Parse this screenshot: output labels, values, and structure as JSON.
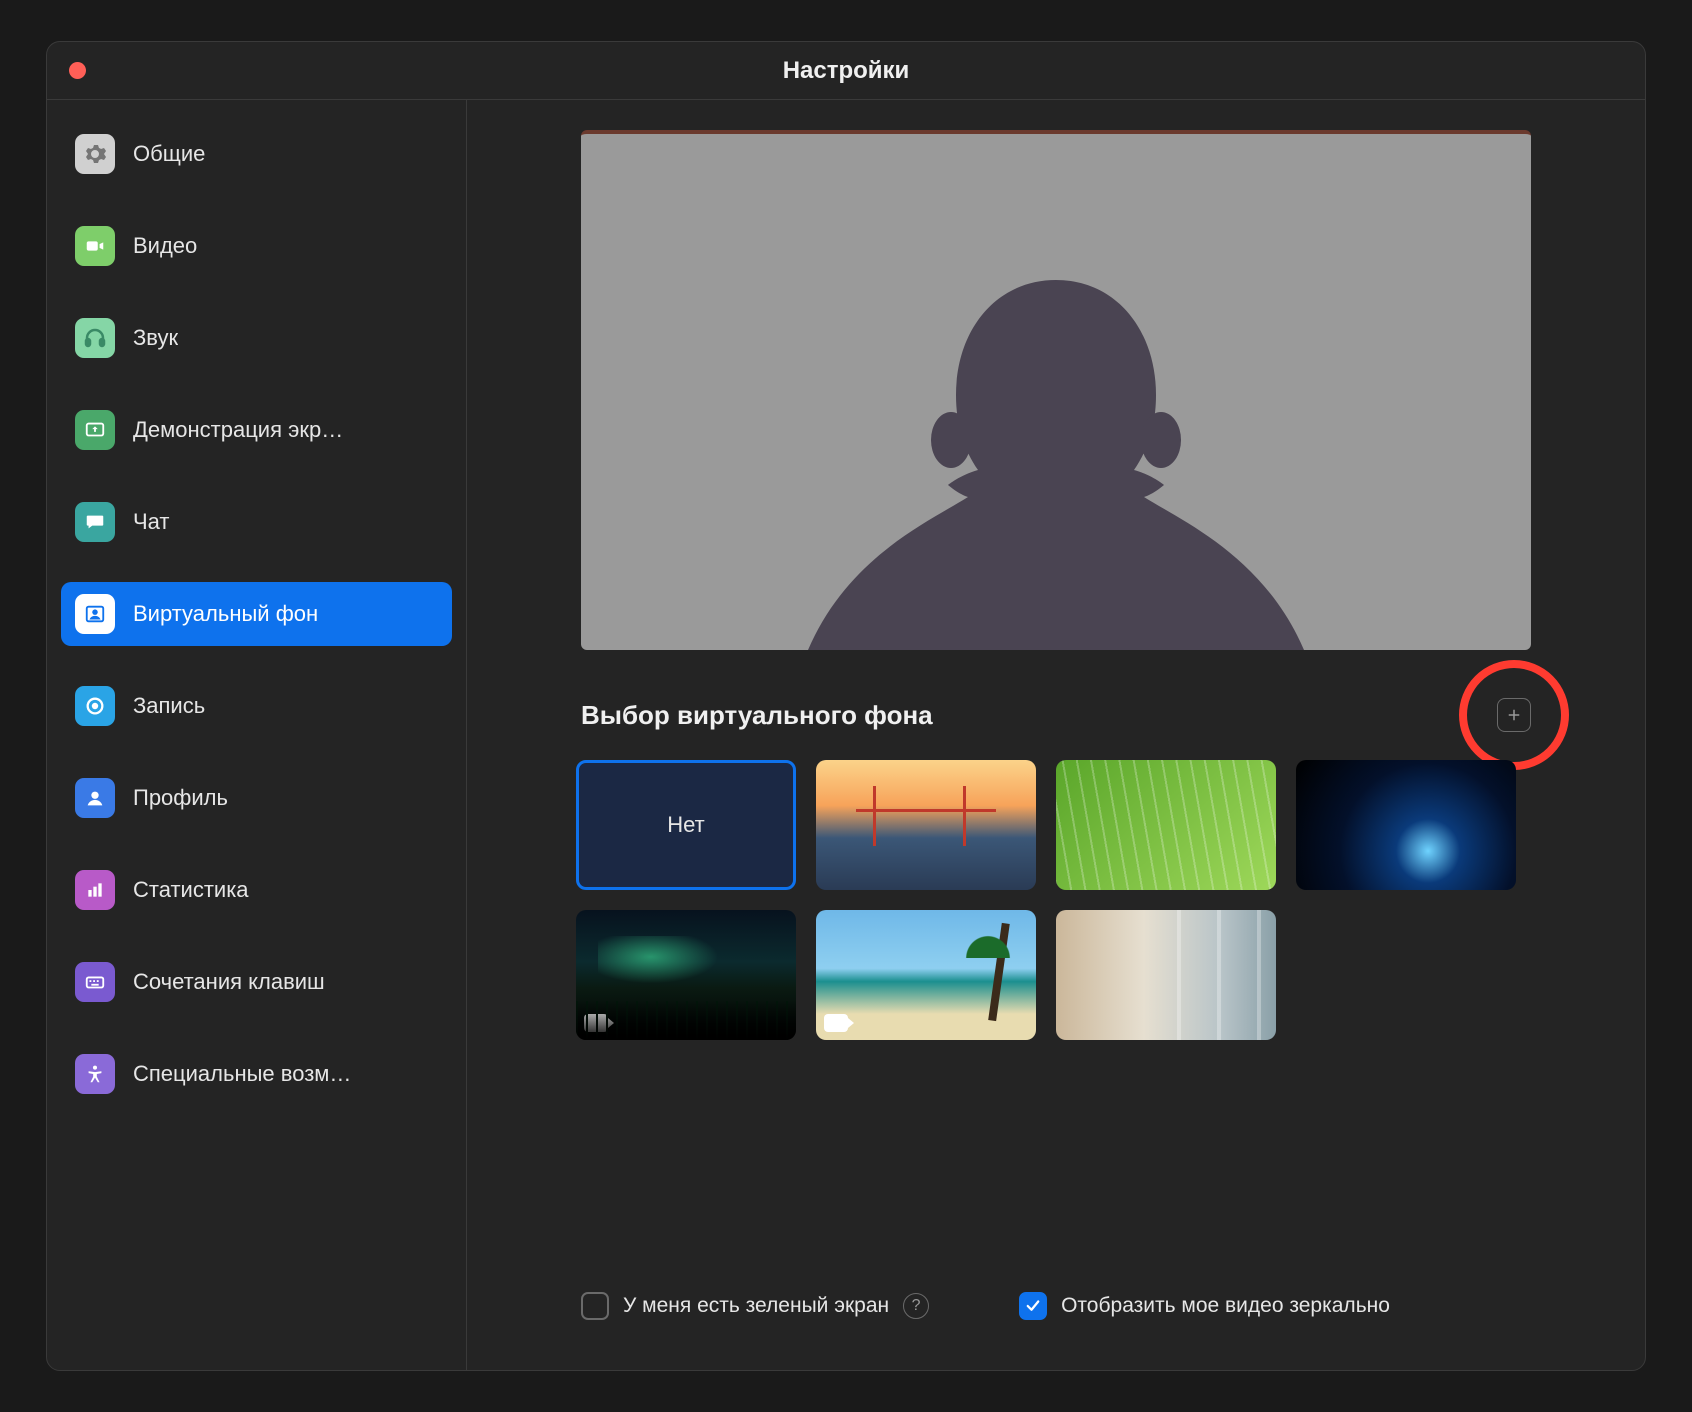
{
  "window": {
    "title": "Настройки"
  },
  "sidebar": {
    "items": [
      {
        "label": "Общие",
        "icon": "gear-icon",
        "bg": "#d0d0d0",
        "fg": "#5a5a5a"
      },
      {
        "label": "Видео",
        "icon": "video-icon",
        "bg": "#7ece6a",
        "fg": "#ffffff"
      },
      {
        "label": "Звук",
        "icon": "headphones-icon",
        "bg": "#85d6a6",
        "fg": "#3a8a66"
      },
      {
        "label": "Демонстрация экр…",
        "icon": "share-screen-icon",
        "bg": "#4aa86a",
        "fg": "#ffffff"
      },
      {
        "label": "Чат",
        "icon": "chat-icon",
        "bg": "#3aa6a0",
        "fg": "#ffffff"
      },
      {
        "label": "Виртуальный фон",
        "icon": "virtual-bg-icon",
        "bg": "#ffffff",
        "fg": "#0e72ed",
        "active": true
      },
      {
        "label": "Запись",
        "icon": "record-icon",
        "bg": "#2aa4e6",
        "fg": "#ffffff"
      },
      {
        "label": "Профиль",
        "icon": "profile-icon",
        "bg": "#3a7ae6",
        "fg": "#ffffff"
      },
      {
        "label": "Статистика",
        "icon": "stats-icon",
        "bg": "#b85ac8",
        "fg": "#ffffff"
      },
      {
        "label": "Сочетания клавиш",
        "icon": "keyboard-icon",
        "bg": "#7a5ad0",
        "fg": "#ffffff"
      },
      {
        "label": "Специальные возм…",
        "icon": "accessibility-icon",
        "bg": "#8a6ad8",
        "fg": "#ffffff"
      }
    ]
  },
  "main": {
    "section_title": "Выбор виртуального фона",
    "none_label": "Нет",
    "backgrounds": [
      {
        "name": "none",
        "selected": true
      },
      {
        "name": "golden-gate-bridge"
      },
      {
        "name": "grass"
      },
      {
        "name": "earth-from-space"
      },
      {
        "name": "aurora",
        "is_video": true
      },
      {
        "name": "beach",
        "is_video": true
      },
      {
        "name": "room-interior"
      }
    ],
    "options": {
      "green_screen": {
        "label": "У меня есть зеленый экран",
        "checked": false
      },
      "mirror": {
        "label": "Отобразить мое видео зеркально",
        "checked": true
      }
    }
  },
  "annotation": {
    "highlight": "add-background-button"
  }
}
